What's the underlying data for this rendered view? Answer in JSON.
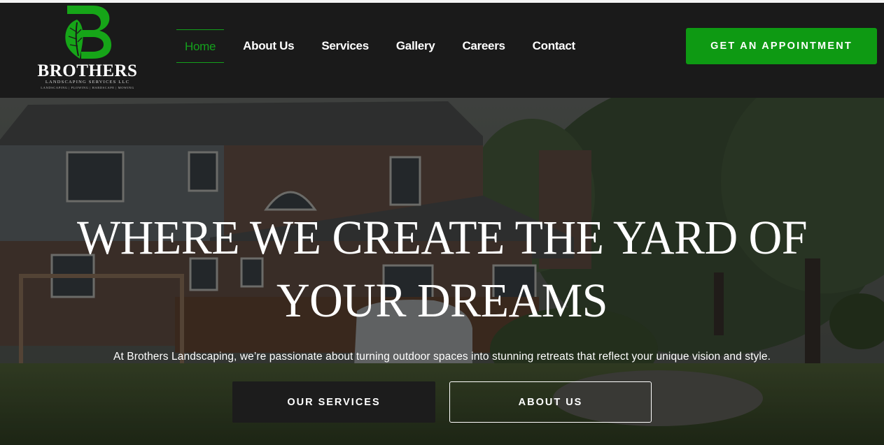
{
  "brand": {
    "name": "BROTHERS",
    "subtitle": "LANDSCAPING SERVICES LLC",
    "tagline": "LANDSCAPING | PLOWING | HARDSCAPE | MOWING",
    "accent_color": "#0e9a13",
    "logo_icon": "leaf-b-icon"
  },
  "nav": {
    "items": [
      {
        "label": "Home",
        "active": true
      },
      {
        "label": "About Us"
      },
      {
        "label": "Services"
      },
      {
        "label": "Gallery"
      },
      {
        "label": "Careers"
      },
      {
        "label": "Contact"
      }
    ],
    "cta_label": "GET AN APPOINTMENT"
  },
  "hero": {
    "title": "WHERE WE CREATE THE YARD OF YOUR DREAMS",
    "description": "At Brothers Landscaping, we’re passionate about turning outdoor spaces into stunning retreats that reflect your unique vision and style.",
    "primary_button": "OUR SERVICES",
    "secondary_button": "ABOUT US"
  }
}
